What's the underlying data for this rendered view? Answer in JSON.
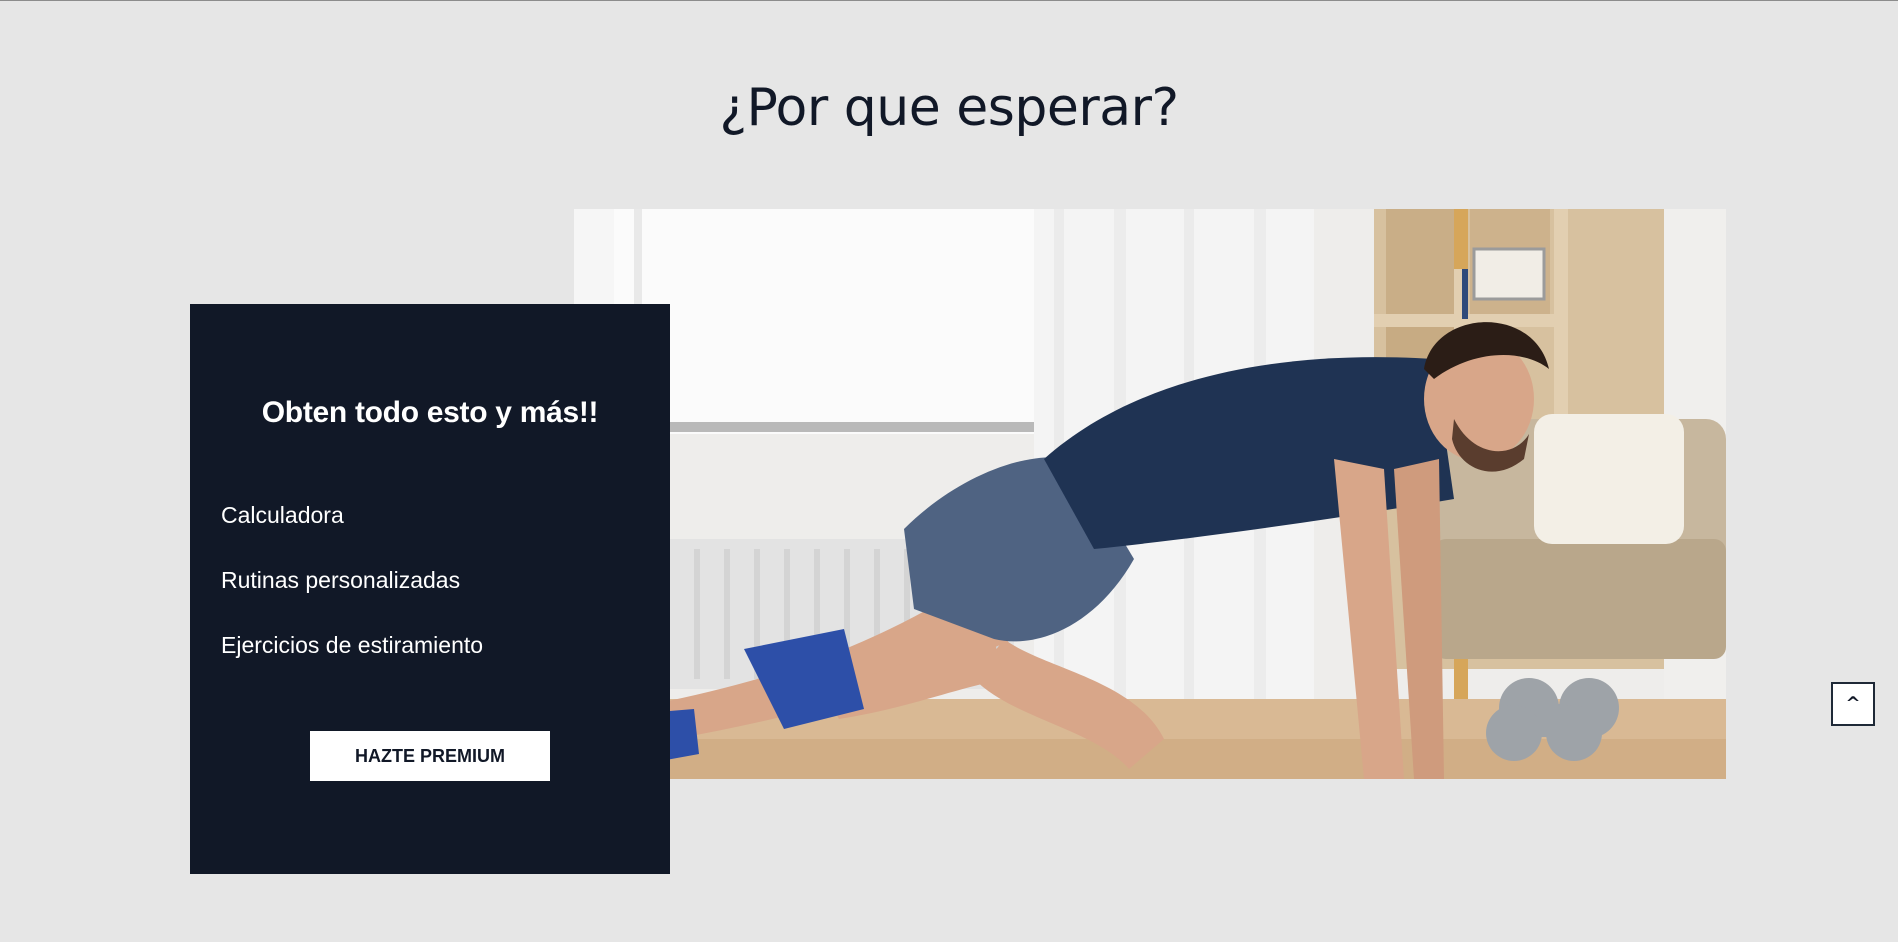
{
  "section": {
    "title": "¿Por que esperar?"
  },
  "promo_card": {
    "title": "Obten todo esto y más!!",
    "features": [
      "Calculadora",
      "Rutinas personalizadas",
      "Ejercicios de estiramiento"
    ],
    "button_label": "HAZTE PREMIUM"
  },
  "photo": {
    "subject": "man-doing-mountain-climber-exercise"
  },
  "scroll_top": {
    "label": "^"
  },
  "colors": {
    "page_background": "#e6e6e6",
    "card_background": "#111827",
    "heading": "#111827",
    "button_background": "#ffffff"
  }
}
